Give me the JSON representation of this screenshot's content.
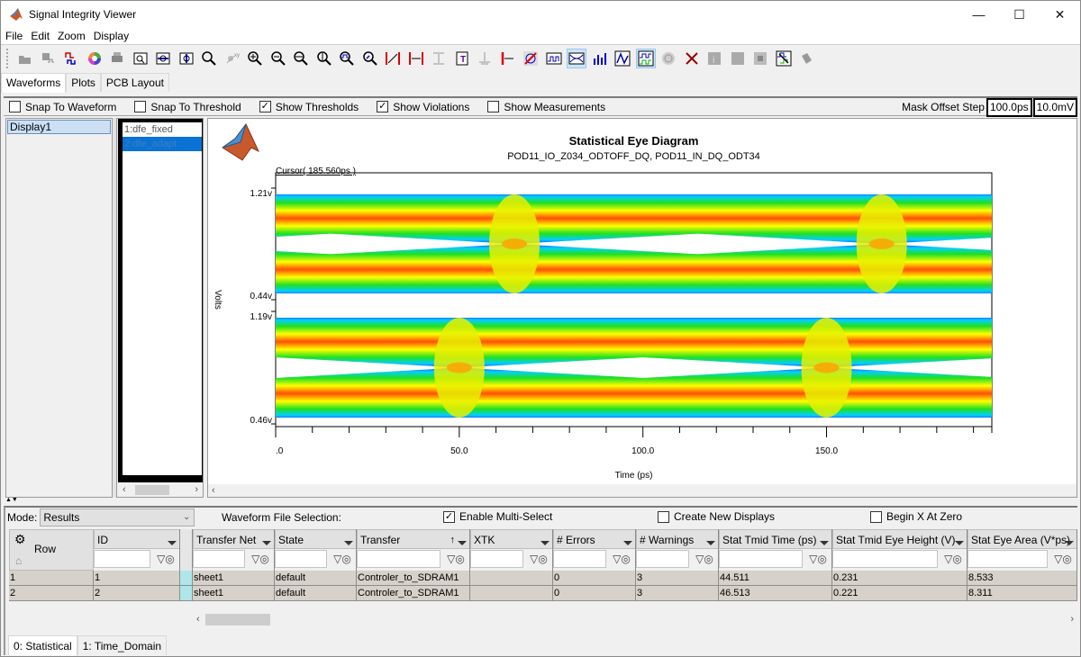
{
  "window": {
    "title": "Signal Integrity Viewer",
    "controls": [
      "minimize",
      "maximize",
      "close"
    ]
  },
  "menu": [
    "File",
    "Edit",
    "Zoom",
    "Display"
  ],
  "toolbar": {
    "buttons": [
      {
        "name": "open-icon",
        "active": false
      },
      {
        "name": "open-waveform-icon",
        "active": false
      },
      {
        "name": "load-waveform-icon",
        "active": false
      },
      {
        "name": "color-wheel-icon",
        "active": false
      },
      {
        "name": "print-icon",
        "active": false
      },
      {
        "name": "zoom-box-icon",
        "active": false
      },
      {
        "name": "zoom-fit-horizontal-icon",
        "active": false
      },
      {
        "name": "zoom-fit-vertical-icon",
        "active": false
      },
      {
        "name": "magnifier-icon",
        "active": false
      },
      {
        "name": "xy-cursor-icon",
        "active": false
      },
      {
        "name": "zoom-in-icon",
        "active": false
      },
      {
        "name": "zoom-out-icon",
        "active": false
      },
      {
        "name": "zoom-horizontal-icon",
        "active": false
      },
      {
        "name": "zoom-vertical-icon",
        "active": false
      },
      {
        "name": "zoom-waveform-icon",
        "active": false
      },
      {
        "name": "zoom-previous-icon",
        "active": false
      },
      {
        "name": "delta-cursor-icon",
        "active": false
      },
      {
        "name": "horizontal-measure-icon",
        "active": false
      },
      {
        "name": "vertical-measure-icon",
        "active": false
      },
      {
        "name": "text-annotation-icon",
        "active": false
      },
      {
        "name": "ground-reference-icon",
        "active": false
      },
      {
        "name": "cursor-left-icon",
        "active": false
      },
      {
        "name": "no-sync-icon",
        "active": false
      },
      {
        "name": "digital-waveform-icon",
        "active": false
      },
      {
        "name": "eye-diagram-icon",
        "active": true
      },
      {
        "name": "histogram-icon",
        "active": false
      },
      {
        "name": "analog-waveform-icon",
        "active": false
      },
      {
        "name": "statistical-waveform-icon",
        "active": true
      },
      {
        "name": "target-icon",
        "active": false
      },
      {
        "name": "delete-icon",
        "active": false
      },
      {
        "name": "info-icon",
        "active": false
      },
      {
        "name": "blank-1-icon",
        "active": false
      },
      {
        "name": "blank-2-icon",
        "active": false
      },
      {
        "name": "waveform-compare-icon",
        "active": false
      },
      {
        "name": "erase-icon",
        "active": false
      }
    ]
  },
  "tabs": [
    {
      "label": "Waveforms",
      "selected": true
    },
    {
      "label": "Plots",
      "selected": false
    },
    {
      "label": "PCB Layout",
      "selected": false
    }
  ],
  "options": {
    "checkboxes": [
      {
        "label": "Snap To Waveform",
        "checked": false
      },
      {
        "label": "Snap To Threshold",
        "checked": false
      },
      {
        "label": "Show Thresholds",
        "checked": true
      },
      {
        "label": "Show Violations",
        "checked": true
      },
      {
        "label": "Show Measurements",
        "checked": false
      }
    ],
    "mask_offset_label": "Mask Offset Step",
    "mask_offset_time": "100.0ps",
    "mask_offset_volt": "10.0mV"
  },
  "displays": [
    "Display1"
  ],
  "waveforms": [
    {
      "label": "1:dfe_fixed",
      "selected": false
    },
    {
      "label": "2:dfe_adapt",
      "selected": true
    }
  ],
  "chart_data": {
    "type": "heatmap",
    "title": "Statistical Eye Diagram",
    "subtitle": "POD11_IO_Z034_ODTOFF_DQ, POD11_IN_DQ_ODT34",
    "cursor_label": "Cursor( 185.560ps )",
    "xlabel": "Time (ps)",
    "ylabel": "Volts",
    "xlim": [
      0,
      195
    ],
    "x_ticks": [
      ".0",
      "50.0",
      "100.0",
      "150.0"
    ],
    "x_tick_values": [
      0,
      50,
      100,
      150
    ],
    "panels": [
      {
        "name": "dfe_fixed",
        "y_top_label": "1.21v",
        "y_bottom_label": "0.44v",
        "y_top": 1.21,
        "y_bottom": 0.44,
        "crossings_ps": [
          65,
          165
        ]
      },
      {
        "name": "dfe_adapt",
        "y_top_label": "1.19v",
        "y_bottom_label": "0.46v",
        "y_top": 1.19,
        "y_bottom": 0.46,
        "crossings_ps": [
          50,
          150
        ]
      }
    ],
    "colormap": [
      "#1040ff",
      "#00d0ff",
      "#20e020",
      "#ffff00",
      "#ffa000",
      "#ff2000"
    ]
  },
  "results": {
    "mode_label": "Mode:",
    "mode_value": "Results",
    "waveform_file_selection": "Waveform File Selection:",
    "checkboxes": [
      {
        "label": "Enable Multi-Select",
        "checked": true
      },
      {
        "label": "Create New Displays",
        "checked": false
      },
      {
        "label": "Begin X At Zero",
        "checked": false
      }
    ],
    "row_header": "Row",
    "columns": [
      "ID",
      "",
      "Transfer Net",
      "State",
      "Transfer",
      "XTK",
      "# Errors",
      "# Warnings",
      "Stat Tmid Time (ps)",
      "Stat Tmid Eye Height (V)",
      "Stat Eye Area (V*ps)"
    ],
    "rows": [
      {
        "row": "1",
        "cells": [
          "1",
          "",
          "sheet1",
          "default",
          "Controler_to_SDRAM1",
          "",
          "0",
          "3",
          "44.511",
          "0.231",
          "8.533"
        ]
      },
      {
        "row": "2",
        "cells": [
          "2",
          "",
          "sheet1",
          "default",
          "Controler_to_SDRAM1",
          "",
          "0",
          "3",
          "46.513",
          "0.221",
          "8.311"
        ]
      }
    ],
    "bottom_tabs": [
      {
        "label": "0: Statistical",
        "selected": true
      },
      {
        "label": "1: Time_Domain",
        "selected": false
      }
    ]
  }
}
